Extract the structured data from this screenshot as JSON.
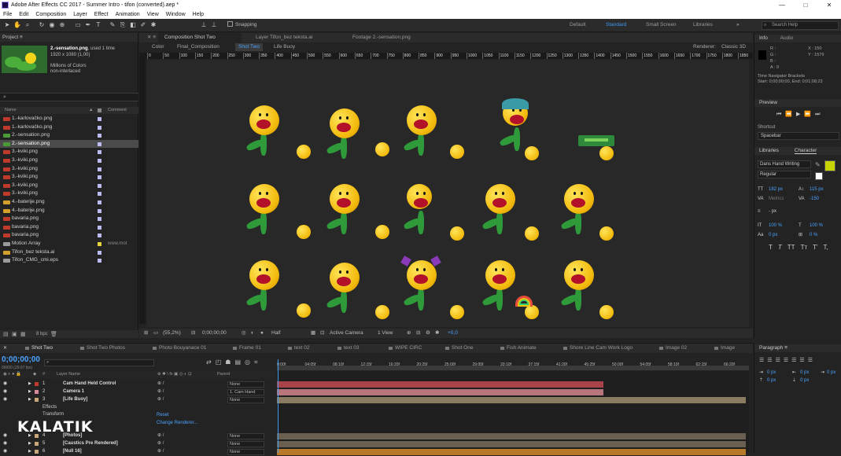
{
  "window": {
    "title": "Adobe After Effects CC 2017 - Summer Intro - tifon (converted).aep *",
    "min": "—",
    "max": "□",
    "close": "✕"
  },
  "menu": [
    "File",
    "Edit",
    "Composition",
    "Layer",
    "Effect",
    "Animation",
    "View",
    "Window",
    "Help"
  ],
  "toolbar": {
    "snapping": "Snapping",
    "workspaces": [
      "Default",
      "Standard",
      "Small Screen",
      "Libraries"
    ],
    "active_workspace": "Standard",
    "search_placeholder": "Search Help"
  },
  "project": {
    "title": "Project",
    "selected_name": "2.-sensation.png",
    "used": ", used 1 time",
    "dims": "1920 x 1080 (1,00)",
    "colors": "Millions of Colors",
    "interlace": "non-interlaced",
    "col_name": "Name",
    "col_comment": "Comment",
    "bpc": "8 bpc",
    "files": [
      {
        "name": "1.-karlovačko.png",
        "c": "r"
      },
      {
        "name": "1.-karlovačko.png",
        "c": "r"
      },
      {
        "name": "2.-sensation.png",
        "c": "g"
      },
      {
        "name": "2.-sensation.png",
        "c": "g",
        "sel": true
      },
      {
        "name": "3.-kviki.png",
        "c": "r"
      },
      {
        "name": "3.-kviki.png",
        "c": "r"
      },
      {
        "name": "3.-kviki.png",
        "c": "r"
      },
      {
        "name": "3.-kviki.png",
        "c": "r"
      },
      {
        "name": "3.-kviki.png",
        "c": "r"
      },
      {
        "name": "3.-kviki.png",
        "c": "r"
      },
      {
        "name": "4.-baterije.png",
        "c": "y"
      },
      {
        "name": "4.-baterije.png",
        "c": "y"
      },
      {
        "name": "bavaria.png",
        "c": "r"
      },
      {
        "name": "bavaria.png",
        "c": "r"
      },
      {
        "name": "bavaria.png",
        "c": "r"
      },
      {
        "name": "Motion Array",
        "c": "w",
        "label": "y",
        "comment": "www.mot"
      },
      {
        "name": "Tifon_bez teksta.ai",
        "c": "y"
      },
      {
        "name": "Tifon_CMG_cmi.eps",
        "c": "w"
      }
    ]
  },
  "viewer": {
    "tabs": [
      "Composition Shot Two",
      "Layer Tifon_bez teksta.ai",
      "Footage 2.-sensation.png"
    ],
    "breadcrumb": [
      "Color",
      "Final_Composition",
      "Shot Two",
      "Life Buoy"
    ],
    "renderer": "Renderer:",
    "renderer_value": "Classic 3D",
    "ruler": [
      "0",
      "50",
      "100",
      "150",
      "200",
      "250",
      "300",
      "350",
      "400",
      "450",
      "500",
      "550",
      "600",
      "650",
      "700",
      "750",
      "800",
      "850",
      "900",
      "950",
      "1000",
      "1050",
      "1100",
      "1150",
      "1200",
      "1250",
      "1300",
      "1350",
      "1400",
      "1450",
      "1500",
      "1550",
      "1600",
      "1650",
      "1700",
      "1750",
      "1800",
      "1850"
    ],
    "footer": {
      "zoom": "(55,2%)",
      "time": "0;00;00;00",
      "res": "Half",
      "camera": "Active Camera",
      "view": "1 View",
      "exposure": "+0,0"
    }
  },
  "info": {
    "tab_info": "Info",
    "tab_audio": "Audio",
    "rgba": [
      "R :",
      "G :",
      "B :",
      "A : 0"
    ],
    "x": "X : 150",
    "y": "Y : 1579",
    "nav1": "Time Navigator Brackets",
    "nav2": "Start: 0;00;00;00, End: 0;01;08;23"
  },
  "preview": {
    "title": "Preview",
    "shortcut_label": "Shortcut",
    "shortcut": "Spacebar"
  },
  "character": {
    "tab_lib": "Libraries",
    "tab_char": "Character",
    "font": "Dans Hand Writing",
    "style": "Regular",
    "size": "182 px",
    "leading": "115 px",
    "kerning": "Metrics",
    "tracking": "-150",
    "stroke": "- px",
    "vscale": "100 %",
    "hscale": "100 %",
    "baseline": "0 px",
    "tsume": "0 %",
    "fill_color": "#c8d400",
    "styles": [
      "T",
      "T",
      "TT",
      "Tт",
      "T'",
      "T,"
    ]
  },
  "paragraph": {
    "title": "Paragraph",
    "indent": [
      "0 px",
      "0 px",
      "0 px",
      "0 px",
      "0 px"
    ]
  },
  "timeline": {
    "tabs": [
      "Shot Two",
      "Shot Two Photos",
      "Photo Bouyanace 01",
      "Frame 01",
      "text 02",
      "text 03",
      "WIPE CIRC",
      "Shot One",
      "Fish Animate",
      "Shore Line Cam Work Logo",
      "Image 02",
      "Image"
    ],
    "timecode": "0;00;00;00",
    "fps": "00000 (29.97 fps)",
    "col_layer": "Layer Name",
    "col_parent": "Parent",
    "ticks": [
      "0:00f",
      "04:05f",
      "08:10f",
      "12:15f",
      "16:20f",
      "20:25f",
      "25:00f",
      "29:05f",
      "33:10f",
      "37:15f",
      "41:20f",
      "45:25f",
      "50:00f",
      "54:05f",
      "58:10f",
      "62:15f",
      "66:20f"
    ],
    "layers": [
      {
        "num": "1",
        "name": "Cam Hand Held Control",
        "parent": "None",
        "color": "#c0392b"
      },
      {
        "num": "2",
        "name": "Camera 1",
        "parent": "1. Cam Hand",
        "color": "#d98a9a"
      },
      {
        "num": "3",
        "name": "[Life Buoy]",
        "parent": "None",
        "color": "#c8a878"
      }
    ],
    "effects": "Effects",
    "transform": "Transform",
    "reset": "Reset",
    "change_renderer": "Change Renderer...",
    "layers2": [
      {
        "num": "4",
        "name": "[Photos]",
        "parent": "None",
        "color": "#c8a878"
      },
      {
        "num": "5",
        "name": "[Caustics Pre Rendered]",
        "parent": "None",
        "color": "#c8a878"
      },
      {
        "num": "6",
        "name": "[Null 16]",
        "parent": "None",
        "color": "#c8a878"
      }
    ]
  },
  "watermark": "KALATIK"
}
